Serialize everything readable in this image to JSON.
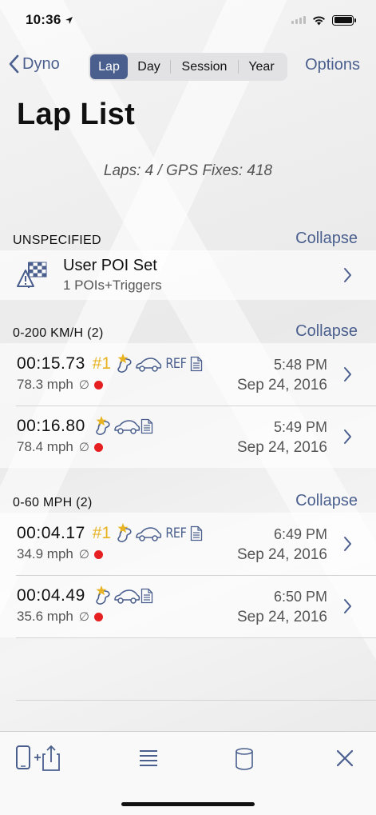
{
  "status": {
    "time": "10:36"
  },
  "nav": {
    "back_label": "Dyno",
    "segments": [
      "Lap",
      "Day",
      "Session",
      "Year"
    ],
    "selected_segment": "Lap",
    "options_label": "Options"
  },
  "page": {
    "title": "Lap List",
    "summary": "Laps: 4 / GPS Fixes: 418"
  },
  "poi_section": {
    "title": "UNSPECIFIED",
    "collapse_label": "Collapse",
    "item": {
      "title": "User POI Set",
      "subtitle": "1 POIs+Triggers"
    }
  },
  "lap_sections": [
    {
      "title": "0-200 KM/H (2)",
      "collapse_label": "Collapse",
      "laps": [
        {
          "time": "00:15.73",
          "rank": "#1",
          "ref": "REF",
          "speed": "78.3 mph",
          "diameter": "∅",
          "clock": "5:48 PM",
          "date": "Sep 24, 2016"
        },
        {
          "time": "00:16.80",
          "rank": "",
          "ref": "",
          "speed": "78.4 mph",
          "diameter": "∅",
          "clock": "5:49 PM",
          "date": "Sep 24, 2016"
        }
      ]
    },
    {
      "title": "0-60 MPH (2)",
      "collapse_label": "Collapse",
      "laps": [
        {
          "time": "00:04.17",
          "rank": "#1",
          "ref": "REF",
          "speed": "34.9 mph",
          "diameter": "∅",
          "clock": "6:49 PM",
          "date": "Sep 24, 2016"
        },
        {
          "time": "00:04.49",
          "rank": "",
          "ref": "",
          "speed": "35.6 mph",
          "diameter": "∅",
          "clock": "6:50 PM",
          "date": "Sep 24, 2016"
        }
      ]
    }
  ],
  "toolbar": {
    "icons": [
      "share-device-icon",
      "list-icon",
      "database-icon",
      "close-icon"
    ]
  },
  "colors": {
    "accent": "#4a5f8e",
    "rank_gold": "#e8b322",
    "record_dot": "#e62020"
  }
}
